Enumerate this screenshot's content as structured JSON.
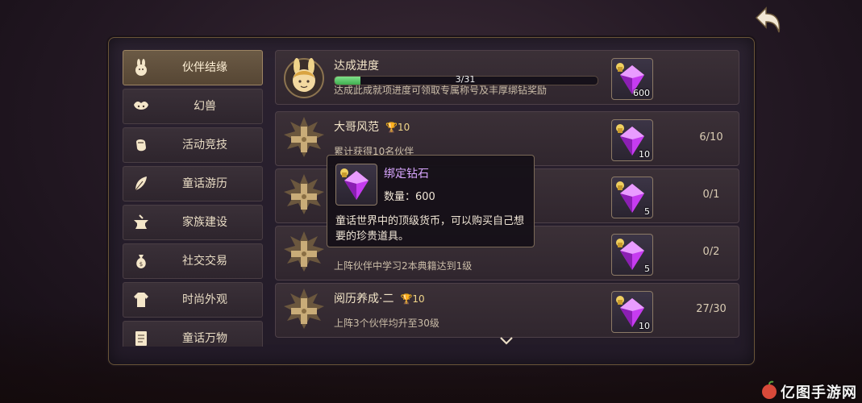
{
  "sidebar": {
    "items": [
      {
        "label": "伙伴结缘",
        "icon": "bunny-icon",
        "active": true
      },
      {
        "label": "幻兽",
        "icon": "beast-icon"
      },
      {
        "label": "活动竞技",
        "icon": "fist-icon"
      },
      {
        "label": "童话游历",
        "icon": "feather-icon"
      },
      {
        "label": "家族建设",
        "icon": "anvil-icon"
      },
      {
        "label": "社交交易",
        "icon": "money-bag-icon"
      },
      {
        "label": "时尚外观",
        "icon": "outfit-icon"
      },
      {
        "label": "童话万物",
        "icon": "book-icon"
      }
    ]
  },
  "summary": {
    "title": "达成进度",
    "progress_text": "3/31",
    "progress_fraction": 0.0968,
    "description": "达成此成就项进度可领取专属称号及丰厚绑钻奖励",
    "reward_count": "600"
  },
  "achievements": [
    {
      "title": "大哥风范",
      "points": "10",
      "description": "累计获得10名伙伴",
      "reward_count": "10",
      "progress": "6/10"
    },
    {
      "title": "",
      "points": "",
      "description": "",
      "reward_count": "5",
      "progress": "0/1"
    },
    {
      "title": "",
      "points": "",
      "description": "上阵伙伴中学习2本典籍达到1级",
      "reward_count": "5",
      "progress": "0/2"
    },
    {
      "title": "阅历养成·二",
      "points": "10",
      "description": "上阵3个伙伴均升至30级",
      "reward_count": "10",
      "progress": "27/30"
    }
  ],
  "tooltip": {
    "title": "绑定钻石",
    "quantity": "数量：600",
    "description": "童话世界中的顶级货币，可以购买自己想要的珍贵道具。"
  },
  "watermark": {
    "text": "亿图手游网"
  },
  "colors": {
    "accent_gold": "#e8b84a",
    "gem_purple": "#c63cf0",
    "progress_green": "#4fc15d",
    "tooltip_title": "#d9a6ff"
  }
}
